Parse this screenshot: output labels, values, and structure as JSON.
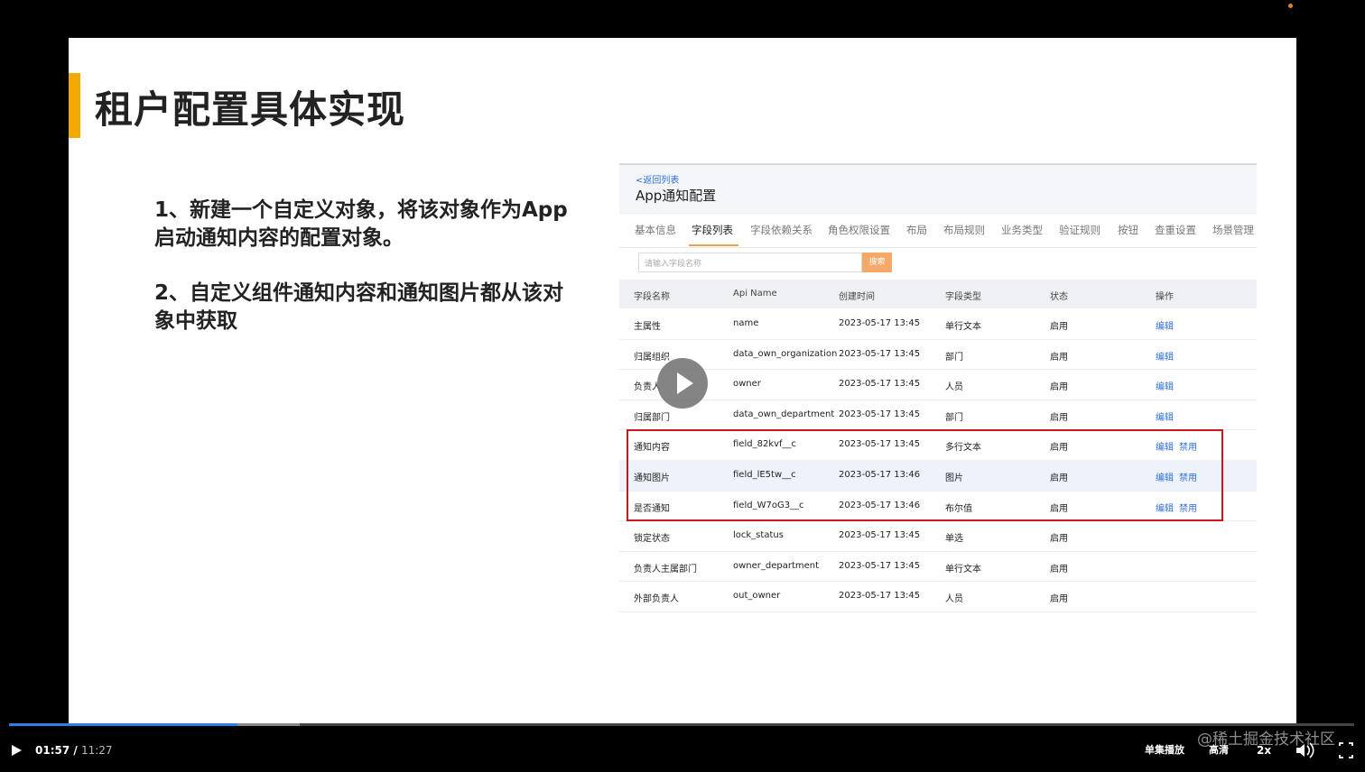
{
  "slide": {
    "title": "租户配置具体实现",
    "points": [
      "1、新建一个自定义对象，将该对象作为App启动通知内容的配置对象。",
      "2、自定义组件通知内容和通知图片都从该对象中获取"
    ]
  },
  "app": {
    "back_link": "<返回列表",
    "title": "App通知配置",
    "tabs": [
      "基本信息",
      "字段列表",
      "字段依赖关系",
      "角色权限设置",
      "布局",
      "布局规则",
      "业务类型",
      "验证规则",
      "按钮",
      "查重设置",
      "场景管理"
    ],
    "active_tab": "字段列表",
    "search_placeholder": "请输入字段名称",
    "search_button": "搜索",
    "columns": [
      "字段名称",
      "Api Name",
      "创建时间",
      "字段类型",
      "状态",
      "操作"
    ],
    "rows": [
      {
        "name": "主属性",
        "api": "name",
        "time": "2023-05-17 13:45",
        "type": "单行文本",
        "status": "启用",
        "edit": "编辑",
        "disable": ""
      },
      {
        "name": "归属组织",
        "api": "data_own_organization",
        "time": "2023-05-17 13:45",
        "type": "部门",
        "status": "启用",
        "edit": "编辑",
        "disable": ""
      },
      {
        "name": "负责人",
        "api": "owner",
        "time": "2023-05-17 13:45",
        "type": "人员",
        "status": "启用",
        "edit": "编辑",
        "disable": ""
      },
      {
        "name": "归属部门",
        "api": "data_own_department",
        "time": "2023-05-17 13:45",
        "type": "部门",
        "status": "启用",
        "edit": "编辑",
        "disable": ""
      },
      {
        "name": "通知内容",
        "api": "field_82kvf__c",
        "time": "2023-05-17 13:45",
        "type": "多行文本",
        "status": "启用",
        "edit": "编辑",
        "disable": "禁用"
      },
      {
        "name": "通知图片",
        "api": "field_lE5tw__c",
        "time": "2023-05-17 13:46",
        "type": "图片",
        "status": "启用",
        "edit": "编辑",
        "disable": "禁用"
      },
      {
        "name": "是否通知",
        "api": "field_W7oG3__c",
        "time": "2023-05-17 13:46",
        "type": "布尔值",
        "status": "启用",
        "edit": "编辑",
        "disable": "禁用"
      },
      {
        "name": "锁定状态",
        "api": "lock_status",
        "time": "2023-05-17 13:45",
        "type": "单选",
        "status": "启用",
        "edit": "",
        "disable": ""
      },
      {
        "name": "负责人主属部门",
        "api": "owner_department",
        "time": "2023-05-17 13:45",
        "type": "单行文本",
        "status": "启用",
        "edit": "",
        "disable": ""
      },
      {
        "name": "外部负责人",
        "api": "out_owner",
        "time": "2023-05-17 13:45",
        "type": "人员",
        "status": "启用",
        "edit": "",
        "disable": ""
      }
    ]
  },
  "player": {
    "current_time": "01:57",
    "separator": " / ",
    "total_time": "11:27",
    "progress_fraction": 0.17,
    "watermark": "@稀土掘金技术社区",
    "single_play": "单集播放",
    "quality": "高清",
    "speed": "2x",
    "icons": [
      "play-icon",
      "volume-icon",
      "fullscreen-icon"
    ],
    "accent_color": "#2d7fe8"
  }
}
